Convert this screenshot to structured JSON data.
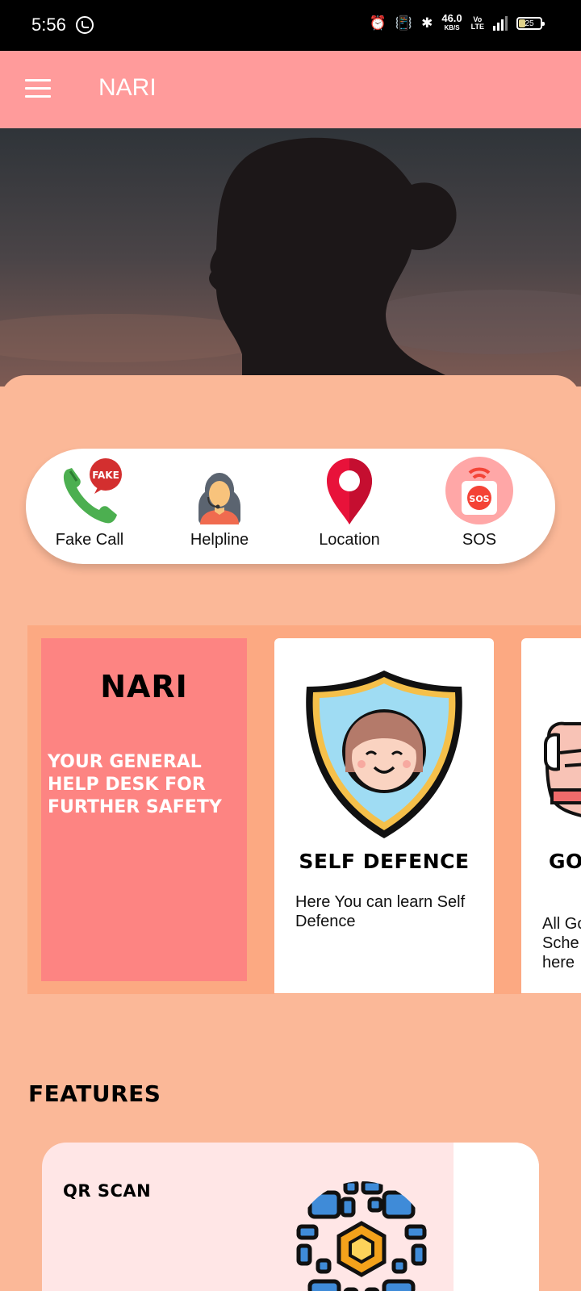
{
  "status_bar": {
    "time": "5:56",
    "net_speed": "46.0",
    "net_unit": "KB/S",
    "volte": "Vo\nLTE",
    "network": "4G",
    "battery": "25"
  },
  "app_bar": {
    "title": "NARI"
  },
  "quick_actions": [
    {
      "label": "Fake Call",
      "icon": "fake-call-icon",
      "badge": "FAKE"
    },
    {
      "label": "Helpline",
      "icon": "helpline-icon"
    },
    {
      "label": "Location",
      "icon": "location-pin-icon"
    },
    {
      "label": "SOS",
      "icon": "sos-icon",
      "badge": "SOS"
    }
  ],
  "carousel": {
    "intro": {
      "title": "NARI",
      "subtitle": "YOUR GENERAL HELP DESK FOR FURTHER SAFETY"
    },
    "cards": [
      {
        "title": "SELF DEFENCE",
        "description": "Here You can learn Self Defence",
        "icon": "shield-girl-icon"
      },
      {
        "title": "GO",
        "description": "All Go\nSche\nhere",
        "icon": "raised-fist-icon"
      }
    ]
  },
  "features": {
    "heading": "FEATURES",
    "items": [
      {
        "label": "QR SCAN",
        "icon": "qr-code-icon"
      }
    ]
  },
  "colors": {
    "app_bar": "#ff9b9b",
    "background": "#fbb898",
    "carousel_bg": "#fca982",
    "intro_card": "#fd8482",
    "feature_card": "#ffe6e6"
  }
}
